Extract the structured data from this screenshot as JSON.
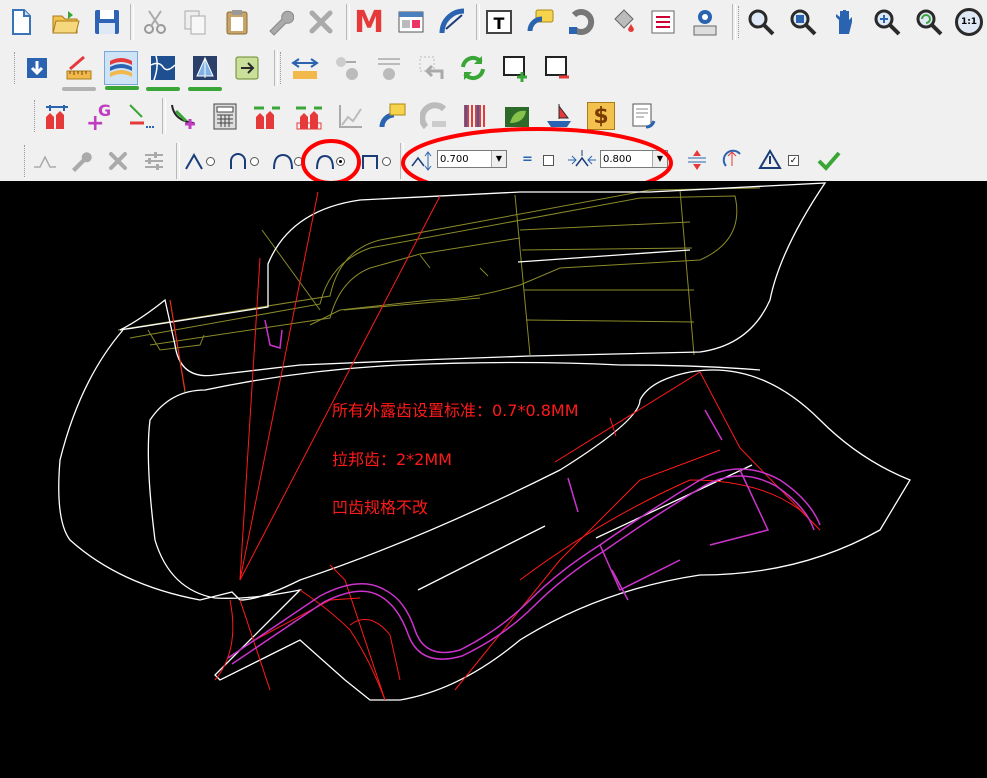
{
  "toolbar": {
    "row1": [
      "new-file",
      "open-folder",
      "save",
      "cut",
      "copy",
      "paste",
      "tools",
      "delete",
      "macro",
      "browser",
      "radar",
      "calendar",
      "comment",
      "undo-curve",
      "paint-bucket",
      "list",
      "settings",
      "zoom",
      "zoom-window",
      "pan",
      "zoom-in",
      "zoom-refresh",
      "zoom-1to1"
    ],
    "zoom_one_label": "1:1",
    "macro_label": "M",
    "calendar_label": "T",
    "g_label": "G",
    "dollar_label": "$"
  },
  "tooth_params": {
    "height_value": "0.700",
    "width_value": "0.800",
    "equal_label": "=",
    "equal_checked": false,
    "tooth_shape_selected": "round-tooth",
    "apply_checked": true
  },
  "annotations": {
    "line1": "所有外露齿设置标准：0.7*0.8MM",
    "line2": "拉邦齿：2*2MM",
    "line3": "凹齿规格不改"
  },
  "colors": {
    "highlight": "#ff0000",
    "canvas": "#000000",
    "outline": "#ffffff",
    "cut_path": "#cc33cc",
    "guide": "#8a8a2a"
  }
}
